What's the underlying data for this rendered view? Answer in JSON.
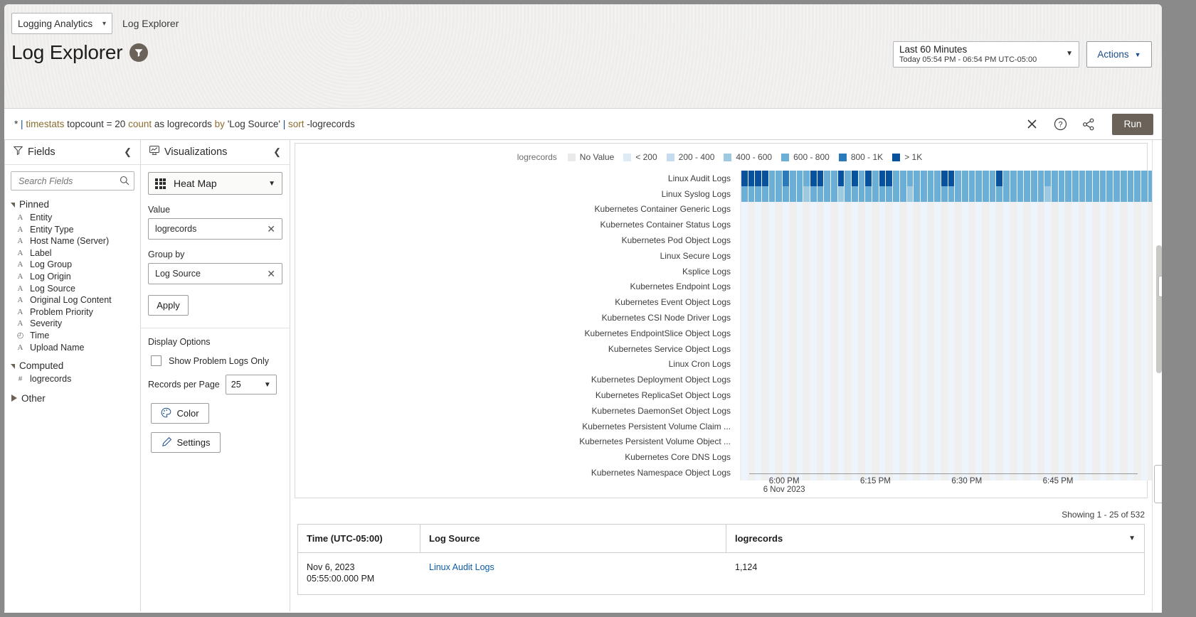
{
  "window": {
    "breadcrumb": {
      "app_selector": "Logging Analytics",
      "current": "Log Explorer"
    },
    "page_title": "Log Explorer"
  },
  "timerange": {
    "label": "Last 60 Minutes",
    "detail": "Today 05:54 PM - 06:54 PM UTC-05:00"
  },
  "actions": {
    "label": "Actions"
  },
  "query": {
    "star": "*",
    "p1": "|",
    "timestats": "timestats",
    "topcount": "topcount = 20",
    "count": "count",
    "as_logrecords": "as logrecords",
    "by": "by",
    "by_field": "'Log Source'",
    "p2": "|",
    "sort": "sort",
    "sort_arg": "-logrecords",
    "run_label": "Run"
  },
  "fields_panel": {
    "title": "Fields",
    "search_placeholder": "Search Fields",
    "groups": [
      {
        "name": "Pinned",
        "expanded": true,
        "items": [
          {
            "type": "A",
            "label": "Entity"
          },
          {
            "type": "A",
            "label": "Entity Type"
          },
          {
            "type": "A",
            "label": "Host Name (Server)"
          },
          {
            "type": "A",
            "label": "Label"
          },
          {
            "type": "A",
            "label": "Log Group"
          },
          {
            "type": "A",
            "label": "Log Origin"
          },
          {
            "type": "A",
            "label": "Log Source"
          },
          {
            "type": "A",
            "label": "Original Log Content"
          },
          {
            "type": "A",
            "label": "Problem Priority"
          },
          {
            "type": "A",
            "label": "Severity"
          },
          {
            "type": "◴",
            "label": "Time"
          },
          {
            "type": "A",
            "label": "Upload Name"
          }
        ]
      },
      {
        "name": "Computed",
        "expanded": true,
        "items": [
          {
            "type": "#",
            "label": "logrecords"
          }
        ]
      },
      {
        "name": "Other",
        "expanded": false,
        "items": []
      }
    ]
  },
  "viz_panel": {
    "title": "Visualizations",
    "selected_viz": "Heat Map",
    "value_label": "Value",
    "value_chip": "logrecords",
    "groupby_label": "Group by",
    "groupby_chip": "Log Source",
    "apply_label": "Apply",
    "display_options_label": "Display Options",
    "problem_logs_label": "Show Problem Logs Only",
    "problem_logs_checked": false,
    "records_per_page_label": "Records per Page",
    "records_per_page_value": "25",
    "color_label": "Color",
    "settings_label": "Settings"
  },
  "chart_data": {
    "type": "heatmap",
    "title": "",
    "legend_title": "logrecords",
    "legend_position": "top",
    "legend": [
      {
        "label": "No Value",
        "color": "#eaeaea"
      },
      {
        "label": "< 200",
        "color": "#deebf7"
      },
      {
        "label": "200 - 400",
        "color": "#c6dbef"
      },
      {
        "label": "400 - 600",
        "color": "#9ecae1"
      },
      {
        "label": "600 - 800",
        "color": "#6baed6"
      },
      {
        "label": "800 - 1K",
        "color": "#2b7bba"
      },
      {
        "label": "> 1K",
        "color": "#08519c"
      }
    ],
    "xlabel": "",
    "ylabel": "",
    "x_tick_labels": [
      "6:00 PM",
      "6:15 PM",
      "6:30 PM",
      "6:45 PM"
    ],
    "x_tick_sub": "6 Nov 2023",
    "x_axis_date": "6 Nov 2023",
    "columns": 60,
    "categories": [
      "Linux Audit Logs",
      "Linux Syslog Logs",
      "Kubernetes Container Generic Logs",
      "Kubernetes Container Status Logs",
      "Kubernetes Pod Object Logs",
      "Linux Secure Logs",
      "Ksplice Logs",
      "Kubernetes Endpoint Logs",
      "Kubernetes Event Object Logs",
      "Kubernetes CSI Node Driver Logs",
      "Kubernetes EndpointSlice Object Logs",
      "Kubernetes Service Object Logs",
      "Linux Cron Logs",
      "Kubernetes Deployment Object Logs",
      "Kubernetes ReplicaSet Object Logs",
      "Kubernetes DaemonSet Object Logs",
      "Kubernetes Persistent Volume Claim ...",
      "Kubernetes Persistent Volume Object ...",
      "Kubernetes Core DNS Logs",
      "Kubernetes Namespace Object Logs"
    ],
    "series": [
      {
        "name": "Linux Audit Logs",
        "values": [
          1124,
          1180,
          1240,
          1190,
          700,
          760,
          820,
          790,
          640,
          600,
          1150,
          1110,
          690,
          660,
          1090,
          700,
          1040,
          740,
          1020,
          680,
          1130,
          1160,
          620,
          650,
          700,
          660,
          700,
          640,
          690,
          1080,
          1150,
          700,
          660,
          690,
          640,
          700,
          680,
          1100,
          660,
          700,
          640,
          690,
          660,
          700,
          680,
          640,
          700,
          660,
          690,
          640,
          700,
          680,
          660,
          700,
          640,
          690,
          660,
          700,
          640,
          680
        ]
      },
      {
        "name": "Linux Syslog Logs",
        "values": [
          700,
          680,
          660,
          700,
          640,
          690,
          660,
          700,
          680,
          500,
          660,
          700,
          640,
          690,
          450,
          660,
          700,
          680,
          640,
          700,
          660,
          690,
          640,
          700,
          520,
          680,
          660,
          700,
          640,
          690,
          660,
          700,
          680,
          640,
          700,
          660,
          690,
          640,
          700,
          680,
          660,
          700,
          640,
          690,
          470,
          700,
          680,
          660,
          700,
          640,
          690,
          660,
          700,
          640,
          680,
          700,
          660,
          690,
          640,
          700
        ]
      },
      {
        "name": "Kubernetes Container Generic Logs",
        "values": []
      },
      {
        "name": "Kubernetes Container Status Logs",
        "values": []
      },
      {
        "name": "Kubernetes Pod Object Logs",
        "values": []
      },
      {
        "name": "Linux Secure Logs",
        "values": []
      },
      {
        "name": "Ksplice Logs",
        "values": []
      },
      {
        "name": "Kubernetes Endpoint Logs",
        "values": []
      },
      {
        "name": "Kubernetes Event Object Logs",
        "values": []
      },
      {
        "name": "Kubernetes CSI Node Driver Logs",
        "values": []
      },
      {
        "name": "Kubernetes EndpointSlice Object Logs",
        "values": []
      },
      {
        "name": "Kubernetes Service Object Logs",
        "values": []
      },
      {
        "name": "Linux Cron Logs",
        "values": []
      },
      {
        "name": "Kubernetes Deployment Object Logs",
        "values": []
      },
      {
        "name": "Kubernetes ReplicaSet Object Logs",
        "values": []
      },
      {
        "name": "Kubernetes DaemonSet Object Logs",
        "values": []
      },
      {
        "name": "Kubernetes Persistent Volume Claim ...",
        "values": []
      },
      {
        "name": "Kubernetes Persistent Volume Object ...",
        "values": []
      },
      {
        "name": "Kubernetes Core DNS Logs",
        "values": []
      },
      {
        "name": "Kubernetes Namespace Object Logs",
        "values": []
      }
    ]
  },
  "results": {
    "showing": "Showing 1 - 25 of 532",
    "columns": [
      "Time (UTC-05:00)",
      "Log Source",
      "logrecords"
    ],
    "rows": [
      {
        "time_line1": "Nov 6, 2023",
        "time_line2": "05:55:00.000 PM",
        "log_source": "Linux Audit Logs",
        "logrecords": "1,124"
      }
    ]
  }
}
